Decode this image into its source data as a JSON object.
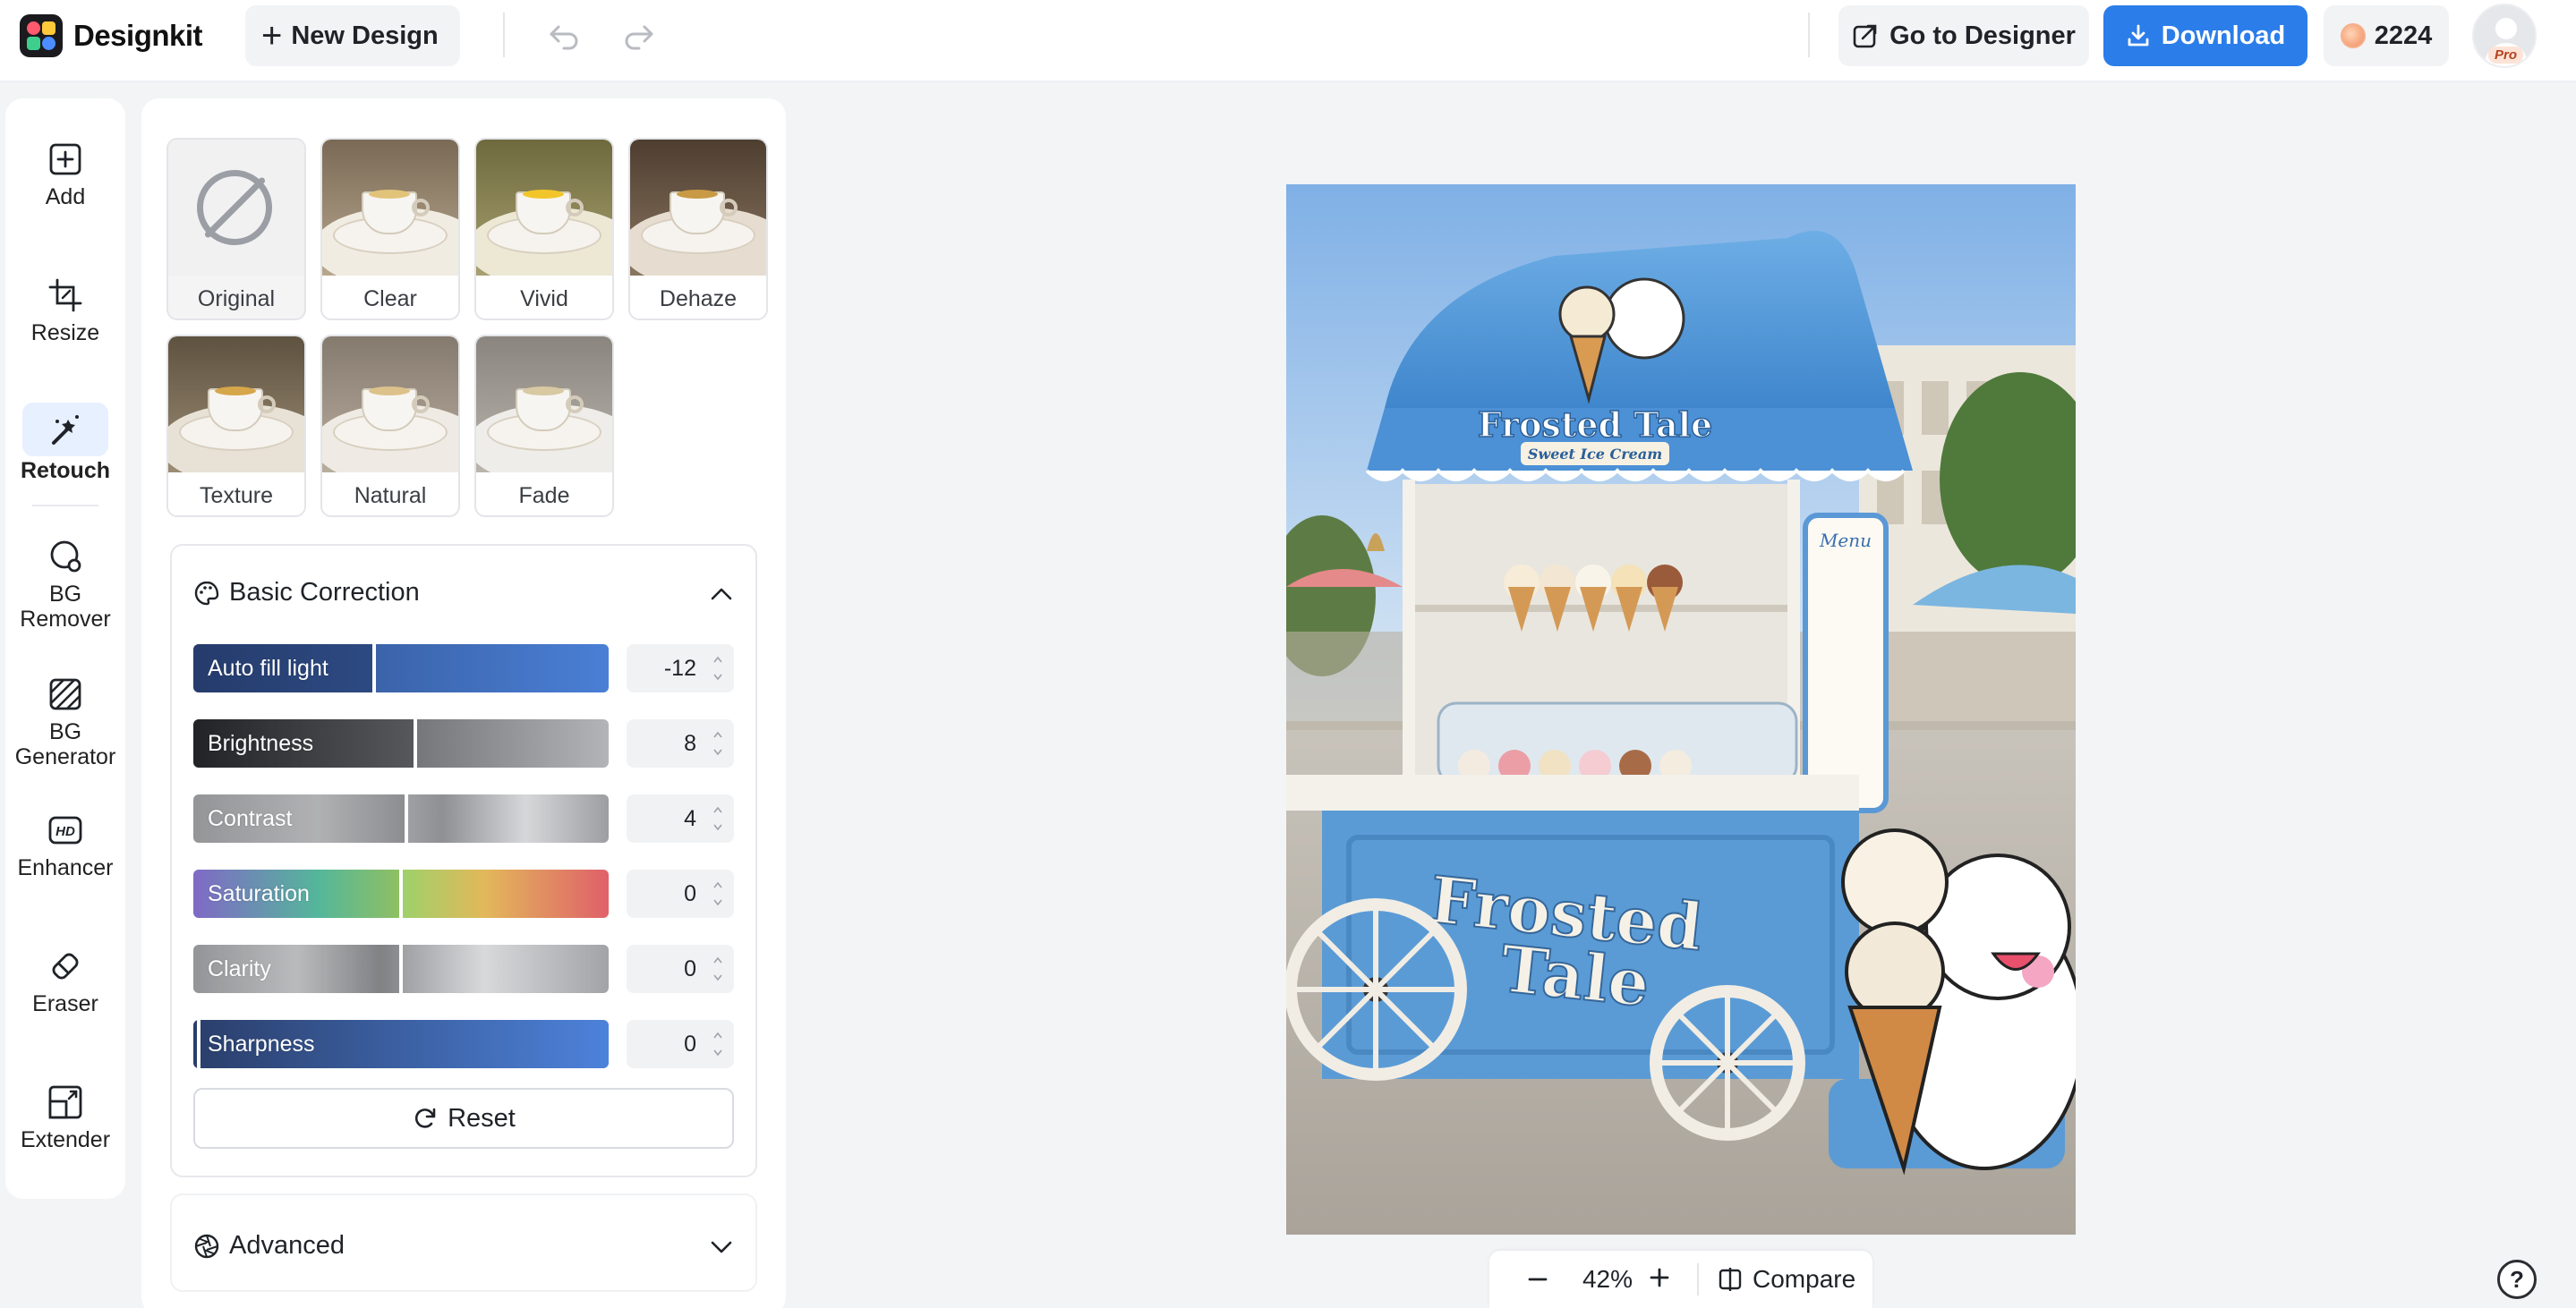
{
  "app": {
    "name": "Designkit",
    "new_design_label": "New Design",
    "go_to_designer_label": "Go to Designer",
    "download_label": "Download",
    "credits": "2224",
    "badge": "Pro"
  },
  "tools": [
    {
      "label": "Add",
      "icon": "add-square-icon"
    },
    {
      "label": "Resize",
      "icon": "crop-icon"
    },
    {
      "label": "Retouch",
      "icon": "magic-wand-icon",
      "active": true
    },
    {
      "label": "BG Remover",
      "icon": "lasso-icon"
    },
    {
      "label": "BG Generator",
      "icon": "hatch-pattern-icon"
    },
    {
      "label": "Enhancer",
      "icon": "hd-icon"
    },
    {
      "label": "Eraser",
      "icon": "eraser-icon"
    },
    {
      "label": "Extender",
      "icon": "expand-frame-icon"
    }
  ],
  "filters": [
    {
      "label": "Original",
      "selected": true
    },
    {
      "label": "Clear"
    },
    {
      "label": "Vivid"
    },
    {
      "label": "Dehaze"
    },
    {
      "label": "Texture"
    },
    {
      "label": "Natural"
    },
    {
      "label": "Fade"
    }
  ],
  "basic_correction": {
    "title": "Basic Correction",
    "sliders": [
      {
        "label": "Auto fill light",
        "value": "-12"
      },
      {
        "label": "Brightness",
        "value": "8"
      },
      {
        "label": "Contrast",
        "value": "4"
      },
      {
        "label": "Saturation",
        "value": "0"
      },
      {
        "label": "Clarity",
        "value": "0"
      },
      {
        "label": "Sharpness",
        "value": "0"
      }
    ],
    "reset_label": "Reset"
  },
  "advanced": {
    "title": "Advanced"
  },
  "canvas": {
    "zoom": "42%",
    "compare_label": "Compare",
    "image": {
      "sign_top": "Frosted Tale",
      "sign_sub": "Sweet Ice Cream",
      "cart_text_1": "Frosted",
      "cart_text_2": "Tale",
      "menu_title": "Menu"
    }
  },
  "colors": {
    "accent": "#2b7de9",
    "cart_blue": "#5b9bd5",
    "active_tool_bg": "#e7f0fe"
  }
}
